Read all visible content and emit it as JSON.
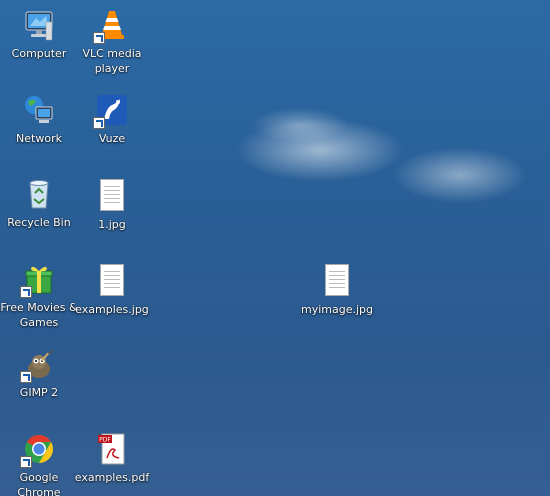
{
  "desktop": {
    "icons": [
      {
        "label": "Computer"
      },
      {
        "label": "VLC media player"
      },
      {
        "label": "Network"
      },
      {
        "label": "Vuze"
      },
      {
        "label": "Recycle Bin"
      },
      {
        "label": "1.jpg"
      },
      {
        "label": "Free Movies & Games"
      },
      {
        "label": "examples.jpg"
      },
      {
        "label": "GIMP 2"
      },
      {
        "label": "Google Chrome"
      },
      {
        "label": "examples.pdf"
      },
      {
        "label": "myimage.jpg"
      }
    ]
  },
  "colors": {
    "sky": "#2b6199",
    "label_text": "#ffffff",
    "chrome_red": "#e23b2e",
    "chrome_yellow": "#f7c51b",
    "chrome_green": "#2fa14a",
    "chrome_blue": "#4a88e8",
    "vlc_orange": "#ff8a00",
    "vuze_blue": "#1e5ab8",
    "pdf_red": "#c0141c"
  }
}
